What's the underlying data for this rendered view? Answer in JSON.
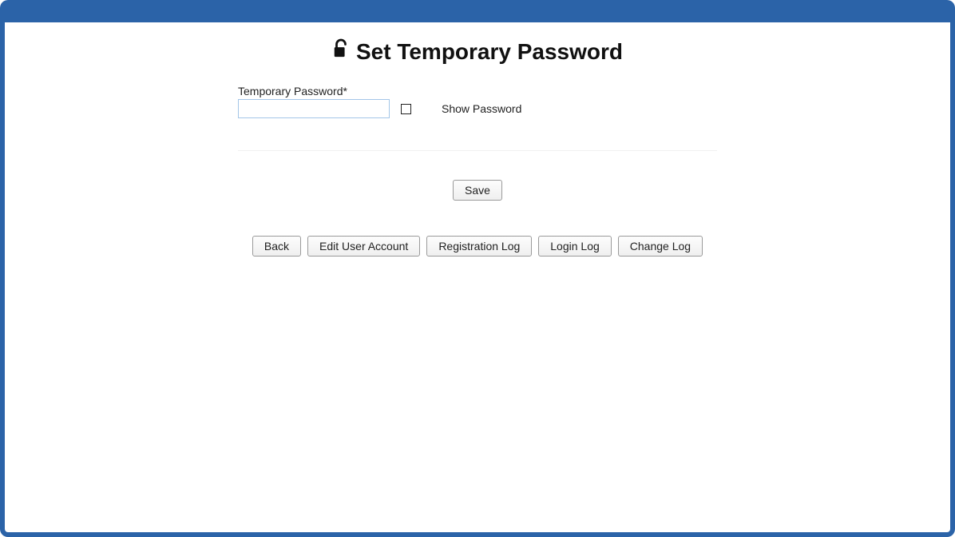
{
  "header": {
    "title": "Set Temporary Password"
  },
  "form": {
    "password_label": "Temporary Password*",
    "password_value": "",
    "show_password_label": "Show Password"
  },
  "actions": {
    "save_label": "Save",
    "back_label": "Back",
    "edit_user_label": "Edit User Account",
    "registration_log_label": "Registration Log",
    "login_log_label": "Login Log",
    "change_log_label": "Change Log"
  }
}
